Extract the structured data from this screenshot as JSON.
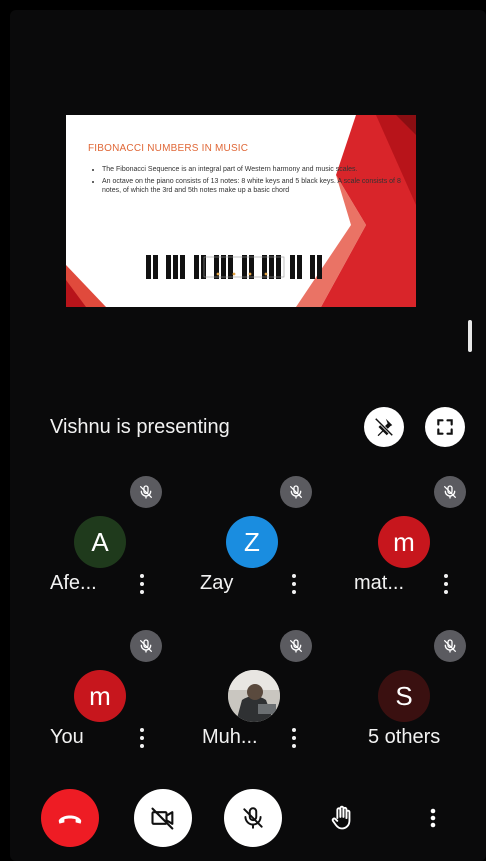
{
  "slide": {
    "title": "FIBONACCI NUMBERS IN MUSIC",
    "bullets": [
      "The Fibonacci Sequence is an integral part of Western harmony and music scales.",
      "An octave on the piano consists of 13 notes: 8 white keys and 5 black keys. A scale consists of 8 notes, of which the 3rd and 5th notes make up a basic chord"
    ]
  },
  "presenting": {
    "label": "Vishnu is presenting",
    "unpin_icon": "pin-off-icon",
    "fullscreen_icon": "fullscreen-icon"
  },
  "participants": [
    {
      "initial": "A",
      "name": "Afe...",
      "avatar_color": "#1f3a1c",
      "muted": true
    },
    {
      "initial": "Z",
      "name": "Zay",
      "avatar_color": "#1a8de0",
      "muted": true
    },
    {
      "initial": "m",
      "name": "mat...",
      "avatar_color": "#c7161d",
      "muted": true
    },
    {
      "initial": "m",
      "name": "You",
      "avatar_color": "#c7161d",
      "muted": true
    },
    {
      "initial": "",
      "name": "Muh...",
      "avatar_color": "#8a8f92",
      "muted": true,
      "photo": true
    },
    {
      "initial": "S",
      "name": "5 others",
      "avatar_color": "#3a1010",
      "muted": true
    }
  ],
  "controls": {
    "end_call_color": "#ee1c24",
    "end_call_icon": "end-call-icon",
    "camera_icon": "camera-off-icon",
    "mic_icon": "mic-off-icon",
    "hand_icon": "raise-hand-icon",
    "more_icon": "more-vert-icon"
  }
}
